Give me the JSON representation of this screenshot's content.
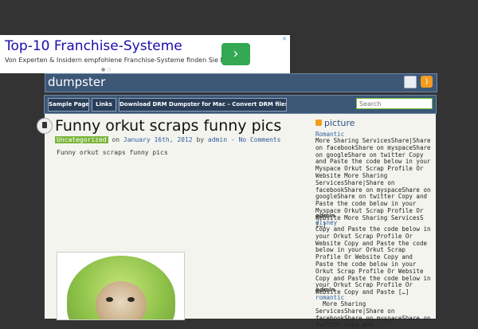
{
  "ad": {
    "title": "Top-10 Franchise-Systeme",
    "description": "Von Experten & Insidern empfohlene Franchise-Systeme finden Sie hier.",
    "button_glyph": "›",
    "close_glyph": "✕",
    "dots": "● ○"
  },
  "header": {
    "site_title": "dumpster"
  },
  "nav": {
    "items": [
      {
        "label": "Sample Page"
      },
      {
        "label": "Links"
      },
      {
        "label": "Download DRM Dumpster for Mac – Convert DRM files to MP3 ..."
      }
    ],
    "search_placeholder": "Search"
  },
  "post": {
    "title": "Funny orkut scraps funny pics",
    "category": "Uncategorized",
    "on": "on",
    "date": "January 16th, 2012",
    "by": "by",
    "author": "admin",
    "separator": "-",
    "comments": "No Comments",
    "body": "Funny orkut scraps funny pics"
  },
  "sidebar": {
    "heading": "picture",
    "entries": [
      {
        "category": "Romantic",
        "text": "More Sharing ServicesShare|Share on facebookShare on myspaceShare on googleShare on twitter Copy and Paste the code below in your Myspace Orkut Scrap Profile Or Website More Sharing ServicesShare|Share on facebookShare on myspaceShare on googleShare on twitter Copy and Paste the code below in your Myspace Orkut Scrap Profile Or Website More Sharing ServicesS […]",
        "author": "admin"
      },
      {
        "category": "disney",
        "text": "Copy and Paste the code below in your Orkut Scrap Profile Or Website Copy and Paste the code below in your Orkut Scrap Profile Or Website Copy and Paste the code below in your Orkut Scrap Profile Or Website Copy and Paste the code below in your Orkut Scrap Profile Or Website Copy and Paste […]",
        "author": "admin"
      },
      {
        "category": "romantic",
        "text": "  More Sharing ServicesShare|Share on facebookShare on myspaceShare on twitter Copy and",
        "author": ""
      }
    ]
  },
  "colors": {
    "page_bg": "#333333",
    "bar_bg": "#3d5777",
    "content_bg": "#f4f4ef",
    "category_badge": "#7ab53b",
    "link": "#2f5d9e",
    "rss": "#f29b1d",
    "ad_button": "#34a853"
  }
}
